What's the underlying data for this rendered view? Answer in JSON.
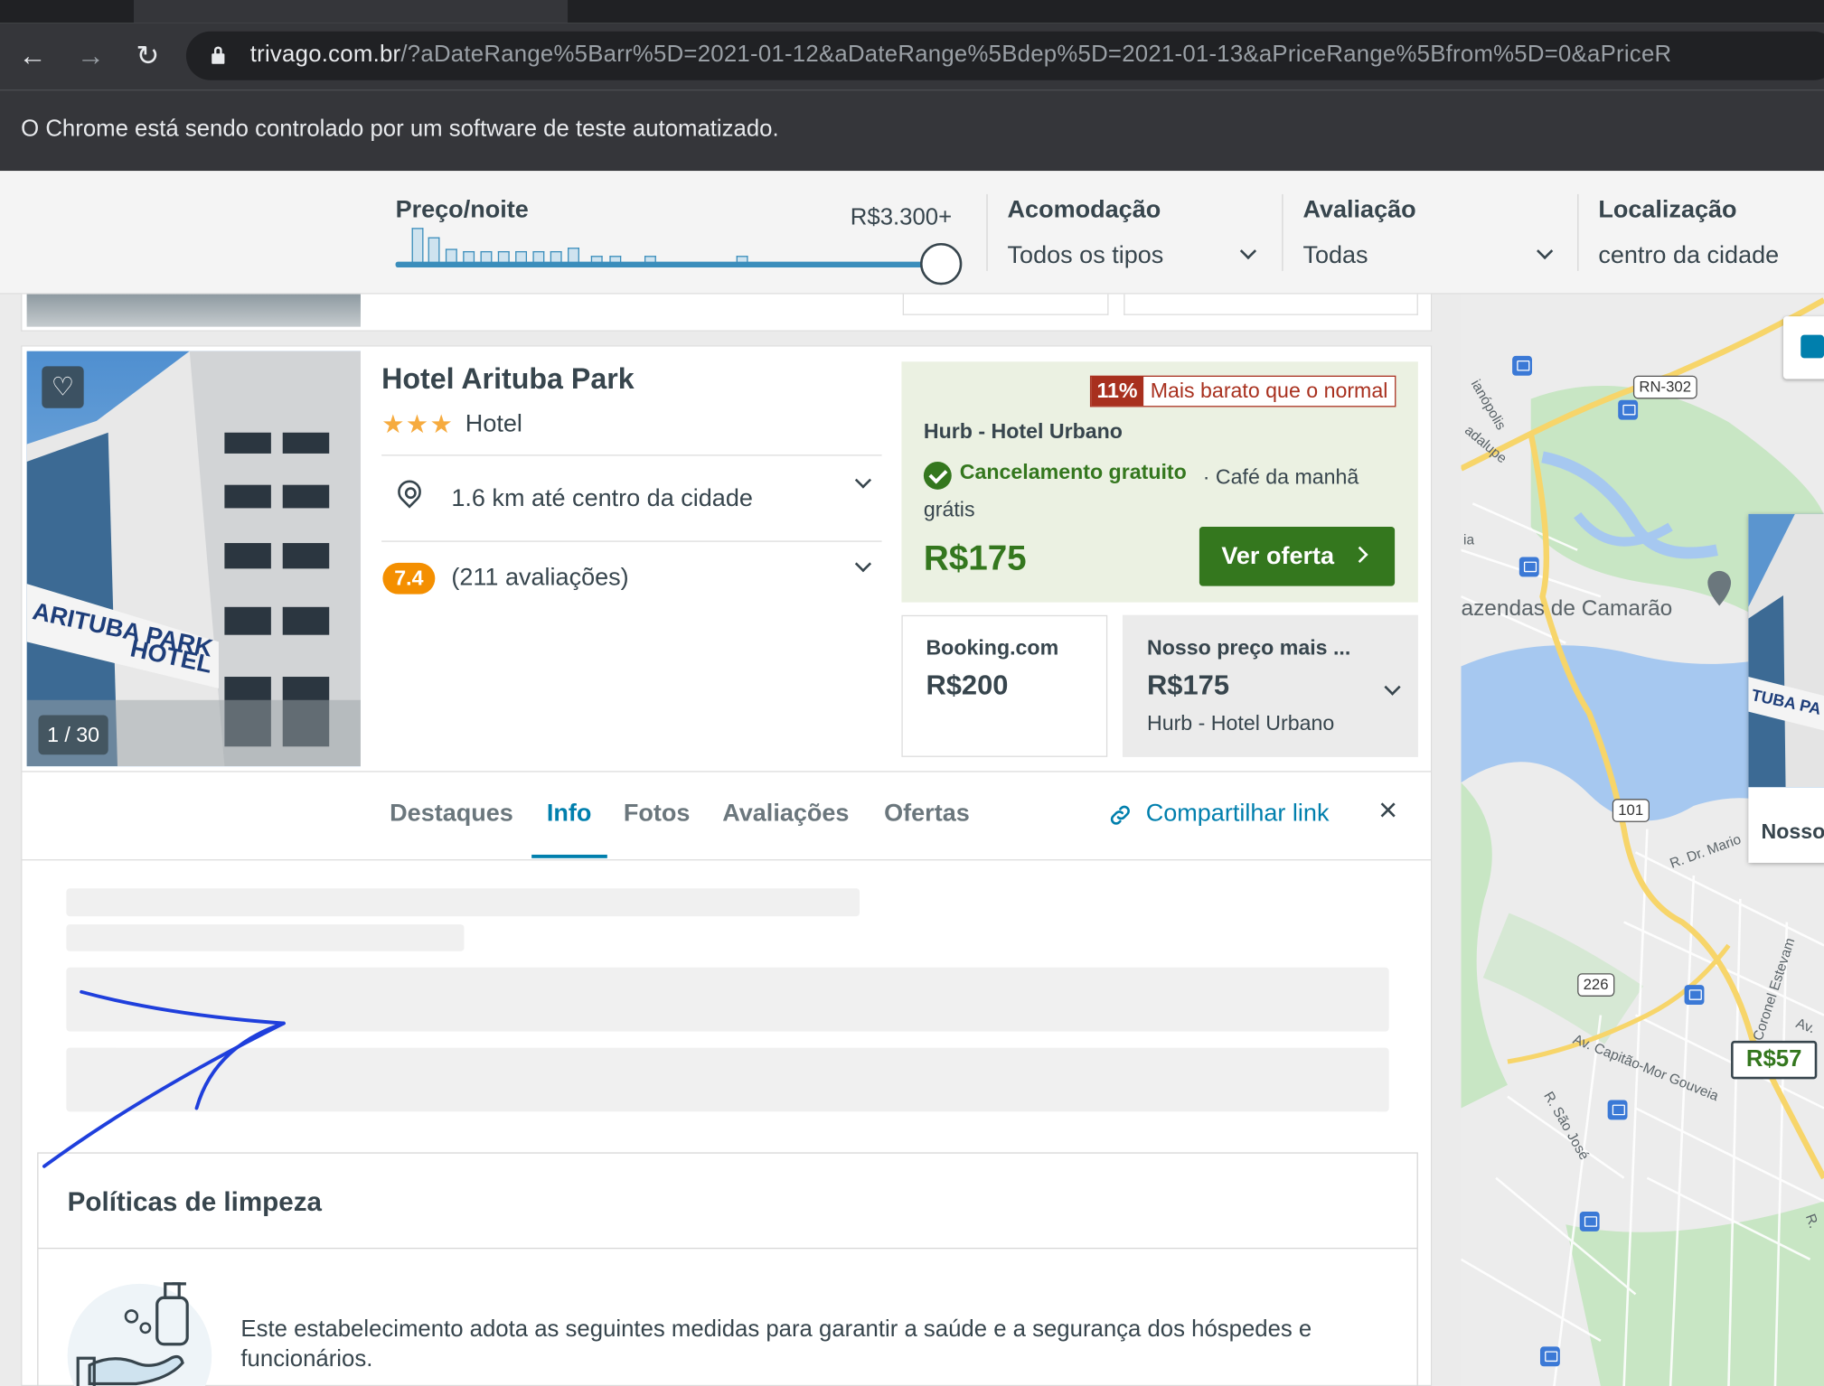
{
  "browser": {
    "url_host": "trivago.com.br",
    "url_rest": "/?aDateRange%5Barr%5D=2021-01-12&aDateRange%5Bdep%5D=2021-01-13&aPriceRange%5Bfrom%5D=0&aPriceR",
    "automation_notice": "O Chrome está sendo controlado por um software de teste automatizado."
  },
  "filters": {
    "price": {
      "label": "Preço/noite",
      "max_value": "R$3.300+"
    },
    "accommodation": {
      "label": "Acomodação",
      "value": "Todos os tipos"
    },
    "rating": {
      "label": "Avaliação",
      "value": "Todas"
    },
    "location": {
      "label": "Localização",
      "value": "centro da cidade"
    }
  },
  "hotel": {
    "name": "Hotel Arituba Park",
    "stars": "★★★",
    "type": "Hotel",
    "distance": "1.6 km até centro da cidade",
    "rating": "7.4",
    "reviews": "(211 avaliações)",
    "image_counter": "1 / 30",
    "image_sign_line1": "ARITUBA PARK",
    "image_sign_line2": "HOTEL"
  },
  "deal": {
    "discount_pct": "11%",
    "discount_text": "Mais barato que o normal",
    "partner": "Hurb - Hotel Urbano",
    "free_cancel": "Cancelamento gratuito",
    "breakfast": "· Café da manhã grátis",
    "price": "R$175",
    "cta": "Ver oferta"
  },
  "offers": [
    {
      "partner": "Booking.com",
      "price": "R$200",
      "sub": ""
    },
    {
      "partner": "Nosso preço mais ...",
      "price": "R$175",
      "sub": "Hurb - Hotel Urbano"
    }
  ],
  "tabs": [
    "Destaques",
    "Info",
    "Fotos",
    "Avaliações",
    "Ofertas"
  ],
  "share_label": "Compartilhar link",
  "close_label": "×",
  "policies": {
    "title": "Políticas de limpeza",
    "text": "Este estabelecimento adota as seguintes medidas para garantir a saúde e a segurança dos hóspedes e funcionários."
  },
  "map": {
    "labels": [
      "azendas de Camarão",
      "R. Dr. Mario",
      "Av. Capitão-Mor Gouveia",
      "R. São José",
      "Av. Coronel Estevam",
      "ianópolis",
      "adalupe",
      "ia",
      "Av.",
      "R."
    ],
    "shields": [
      "RN-302",
      "101",
      "226"
    ],
    "price_marker": "R$57",
    "popup_text": "Nosso",
    "popup_sign": "TUBA PA HOT"
  }
}
